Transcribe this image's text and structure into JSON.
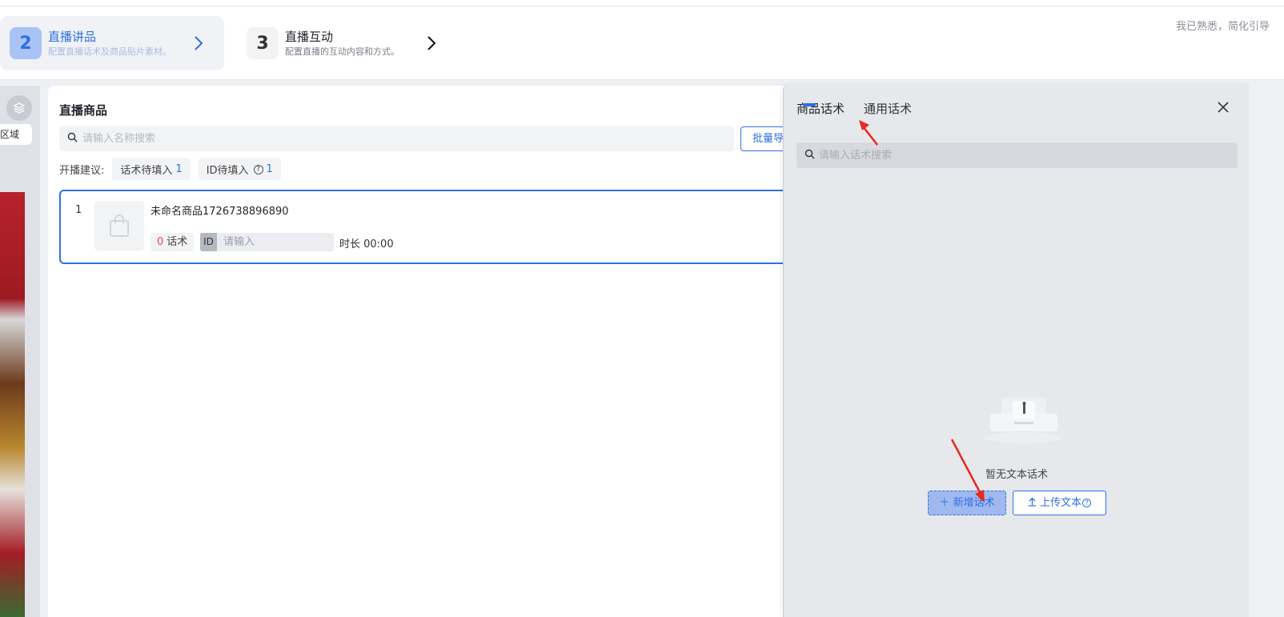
{
  "steps": [
    {
      "number": "2",
      "title": "直播讲品",
      "desc": "配置直播话术及商品贴片素材。"
    },
    {
      "number": "3",
      "title": "直播互动",
      "desc": "配置直播的互动内容和方式。"
    }
  ],
  "skip_guide": "我已熟悉，简化引导",
  "left_panel": {
    "region_label": "区域"
  },
  "products": {
    "title": "直播商品",
    "search_placeholder": "请输入名称搜索",
    "batch_button": "批量导",
    "suggest_label": "开播建议:",
    "chips": [
      {
        "label": "话术待填入",
        "count": "1"
      },
      {
        "label": "ID待填入",
        "count": "1"
      }
    ],
    "items": [
      {
        "index": "1",
        "name": "未命名商品1726738896890",
        "script_count": "0",
        "script_label": "话术",
        "id_tag": "ID",
        "id_placeholder": "请输入",
        "duration": "时长 00:00"
      }
    ]
  },
  "drawer": {
    "tabs": [
      "商品话术",
      "通用话术"
    ],
    "active_tab": 0,
    "search_placeholder": "请输入话术搜索",
    "empty_text": "暂无文本话术",
    "add_button": "新增话术",
    "upload_button": "上传文本"
  },
  "colors": {
    "accent": "#2f6fe4",
    "annotation_arrow": "#e8291c"
  }
}
